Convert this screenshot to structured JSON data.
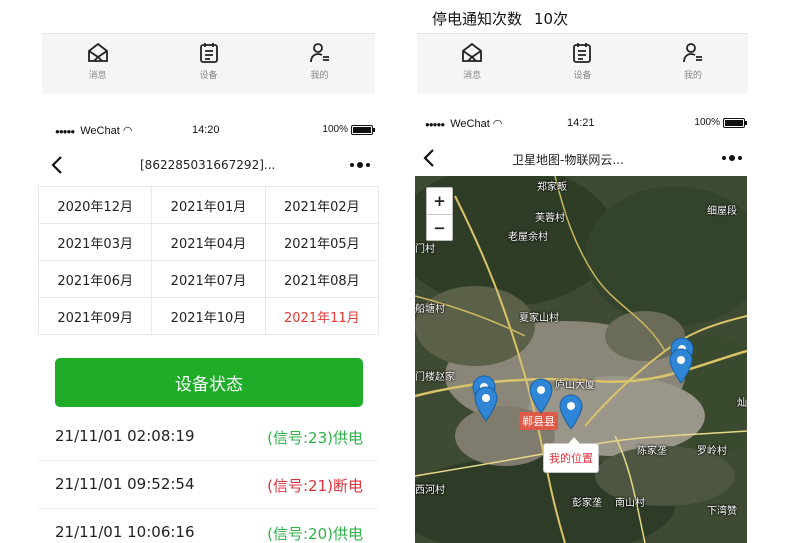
{
  "notice": {
    "label": "停电通知次数",
    "value": "10次"
  },
  "tabbar": [
    {
      "label": "消息",
      "icon": "message-envelope-icon"
    },
    {
      "label": "设备",
      "icon": "device-list-icon"
    },
    {
      "label": "我的",
      "icon": "user-profile-icon"
    }
  ],
  "status_bar": {
    "signal": "●●●●●",
    "carrier": "WeChat",
    "left_time": "14:20",
    "right_time": "14:21",
    "battery": "100%",
    "battery_level": 1.0
  },
  "left_nav": {
    "title": "[862285031667292]..."
  },
  "right_nav": {
    "title": "卫星地图-物联网云..."
  },
  "months": [
    [
      "2020年12月",
      "2021年01月",
      "2021年02月"
    ],
    [
      "2021年03月",
      "2021年04月",
      "2021年05月"
    ],
    [
      "2021年06月",
      "2021年07月",
      "2021年08月"
    ],
    [
      "2021年09月",
      "2021年10月",
      "2021年11月"
    ]
  ],
  "selected_month": "2021年11月",
  "status_button": "设备状态",
  "records": [
    {
      "time": "21/11/01 02:08:19",
      "status": "(信号:23)供电",
      "state": "on"
    },
    {
      "time": "21/11/01 09:52:54",
      "status": "(信号:21)断电",
      "state": "off"
    },
    {
      "time": "21/11/01 10:06:16",
      "status": "(信号:20)供电",
      "state": "on"
    }
  ],
  "map": {
    "zoom_in": "+",
    "zoom_out": "−",
    "places": [
      "郑家畈",
      "芙蓉村",
      "老屋余村",
      "细屋段",
      "门村",
      "船塘村",
      "夏家山村",
      "门楼赵家",
      "庐山大厦",
      "陈家垄",
      "罗岭村",
      "西河村",
      "彭家垄",
      "南山村",
      "下湾赞",
      "灿"
    ],
    "county": "郸县县",
    "my_location": "我的位置"
  },
  "colors": {
    "accent_green": "#1eac29",
    "power_on": "#2db24a",
    "power_off": "#e0313c",
    "selected_month": "#e53935",
    "pin_blue": "#2f86d6"
  }
}
